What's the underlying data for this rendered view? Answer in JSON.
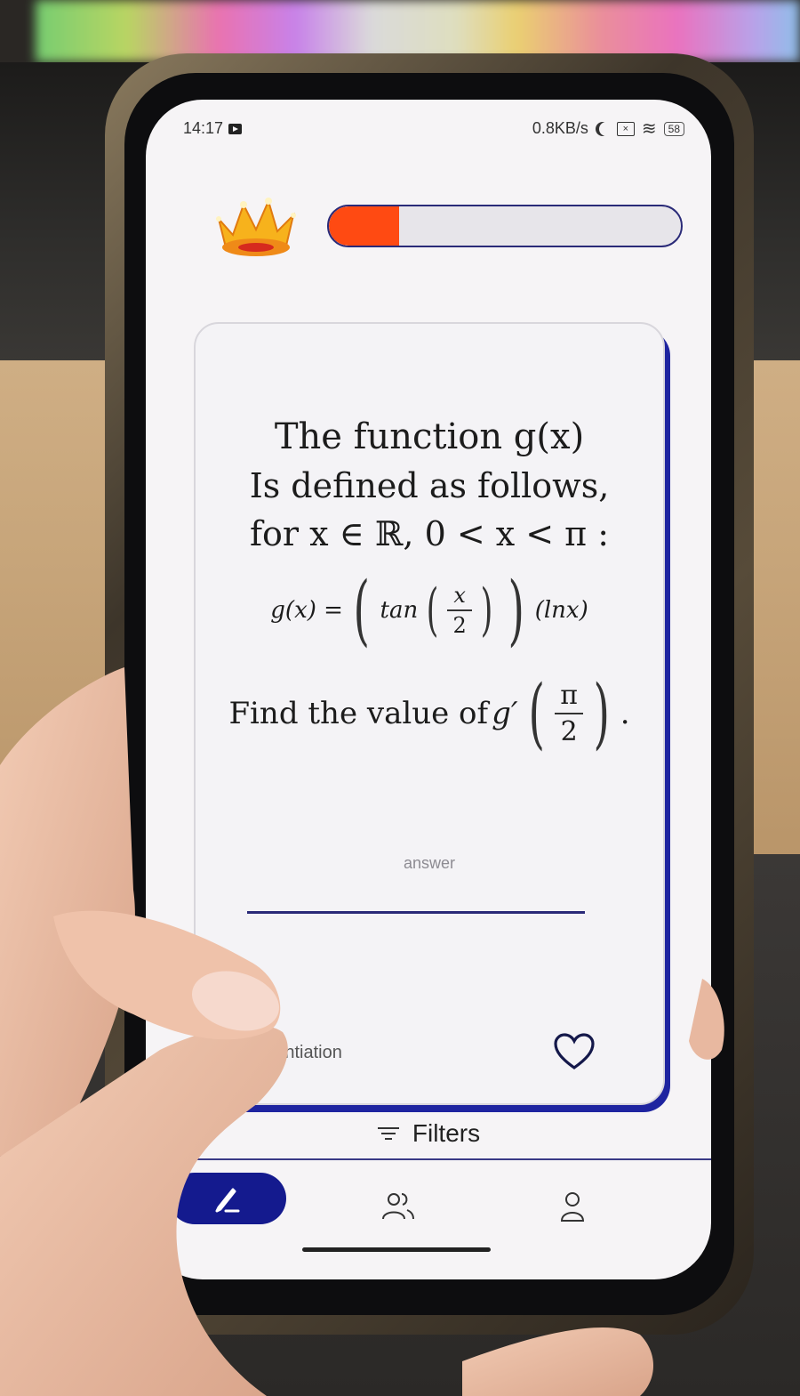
{
  "status_bar": {
    "time": "14:17",
    "network_speed": "0.8KB/s",
    "battery": "58",
    "icons": [
      "screen-record-icon",
      "moon-icon",
      "sim-x-icon",
      "wifi-icon",
      "battery-icon"
    ]
  },
  "quiz": {
    "progress_fraction": 0.2,
    "progress_color": "#ff4a12",
    "accent_color": "#1e24a0",
    "question": {
      "line1": "The function g(x)",
      "line2": "Is defined as follows,",
      "line3": "for x ∈ ℝ, 0 < x < π :",
      "formula_lhs": "g(x) =",
      "formula_tan": "tan",
      "formula_frac_num": "x",
      "formula_frac_den": "2",
      "formula_ln": "(lnx)",
      "find_prefix": "Find the value of",
      "find_func": "g′",
      "find_frac_num": "π",
      "find_frac_den": "2",
      "find_suffix": "."
    },
    "answer_label": "answer",
    "answer_value": "",
    "tags": "s, differentiation"
  },
  "bottom": {
    "filters_label": "Filters",
    "nav": [
      {
        "name": "create",
        "icon": "pen-icon",
        "active": true
      },
      {
        "name": "community",
        "icon": "users-icon",
        "active": false
      },
      {
        "name": "profile",
        "icon": "user-icon",
        "active": false
      }
    ]
  }
}
